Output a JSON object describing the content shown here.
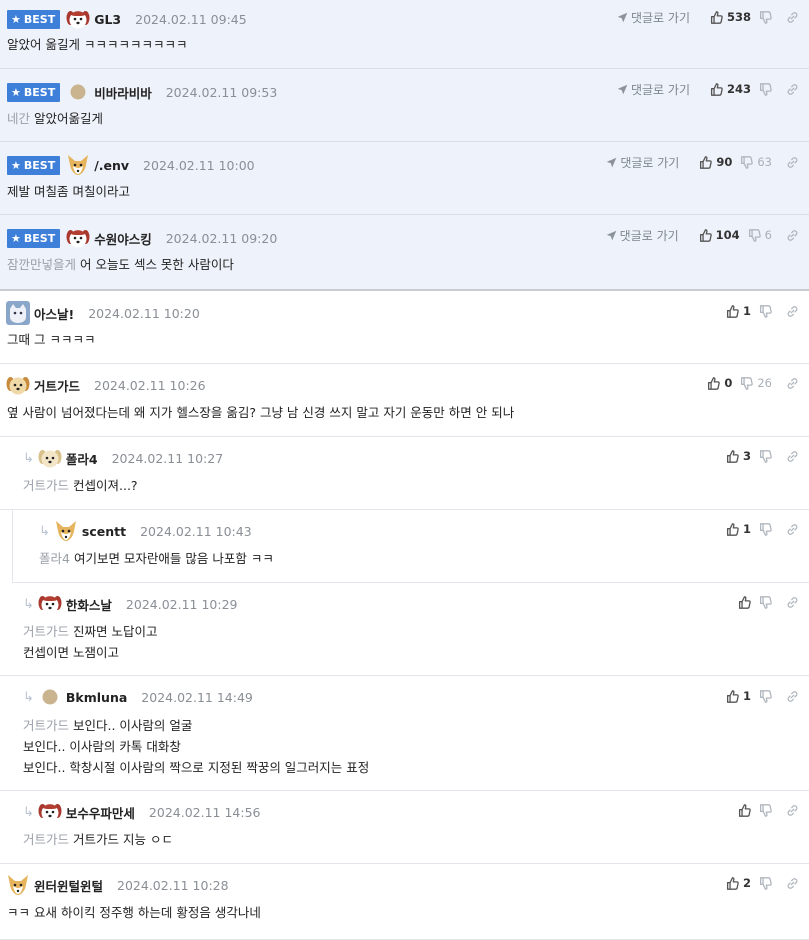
{
  "labels": {
    "best": "BEST",
    "goto_comment": "댓글로 가기"
  },
  "comments": [
    {
      "id": "c1",
      "best": true,
      "avatar": "dog-red",
      "nick": "GL3",
      "date": "2024.02.11 09:45",
      "goto": true,
      "likes": "538",
      "dislikes": "",
      "mention": "",
      "lines": [
        "알았어 옮길게 ㅋㅋㅋㅋㅋㅋㅋㅋㅋ"
      ]
    },
    {
      "id": "c2",
      "best": true,
      "avatar": "dot-tan",
      "nick": "비바라비바",
      "date": "2024.02.11 09:53",
      "goto": true,
      "likes": "243",
      "dislikes": "",
      "mention": "네간",
      "lines": [
        "알았어옮길게"
      ]
    },
    {
      "id": "c3",
      "best": true,
      "avatar": "fox",
      "nick": "/.env",
      "date": "2024.02.11 10:00",
      "goto": true,
      "likes": "90",
      "dislikes": "63",
      "mention": "",
      "lines": [
        "제발 며칠좀 며칠이라고"
      ]
    },
    {
      "id": "c4",
      "best": true,
      "avatar": "dog-red",
      "nick": "수원야스킹",
      "date": "2024.02.11 09:20",
      "goto": true,
      "likes": "104",
      "dislikes": "6",
      "mention": "잠깐만넣을게",
      "lines": [
        "어 오늘도 섹스 못한 사람이다"
      ]
    },
    {
      "id": "c5",
      "best": false,
      "avatar": "cat-blue",
      "nick": "아스날!",
      "date": "2024.02.11 10:20",
      "goto": false,
      "likes": "1",
      "dislikes": "",
      "mention": "",
      "lines": [
        "그때 그 ㅋㅋㅋㅋ"
      ]
    },
    {
      "id": "c6",
      "best": false,
      "avatar": "dog-tan",
      "nick": "거트가드",
      "date": "2024.02.11 10:26",
      "goto": false,
      "likes": "0",
      "dislikes": "26",
      "mention": "",
      "lines": [
        "옆 사람이 넘어졌다는데 왜 지가 헬스장을 옮김? 그냥 남 신경 쓰지 말고 자기 운동만 하면 안 되나"
      ]
    },
    {
      "id": "c7",
      "best": false,
      "reply": 1,
      "avatar": "dog-cream",
      "nick": "폴라4",
      "date": "2024.02.11 10:27",
      "goto": false,
      "likes": "3",
      "dislikes": "",
      "mention": "거트가드",
      "lines": [
        "컨셉이져...?"
      ]
    },
    {
      "id": "c8",
      "best": false,
      "reply": 2,
      "avatar": "fox",
      "nick": "scentt",
      "date": "2024.02.11 10:43",
      "goto": false,
      "likes": "1",
      "dislikes": "",
      "mention": "폴라4",
      "lines": [
        "여기보면 모자란애들 많음 나포함 ㅋㅋ"
      ]
    },
    {
      "id": "c9",
      "best": false,
      "reply": 1,
      "avatar": "dog-red",
      "nick": "한화스날",
      "date": "2024.02.11 10:29",
      "goto": false,
      "likes": "",
      "dislikes": "",
      "mention": "거트가드",
      "lines": [
        "진짜면 노답이고",
        "컨셉이면 노잼이고"
      ]
    },
    {
      "id": "c10",
      "best": false,
      "reply": 1,
      "avatar": "dot-tan",
      "nick": "Bkmluna",
      "date": "2024.02.11 14:49",
      "goto": false,
      "likes": "1",
      "dislikes": "",
      "mention": "거트가드",
      "lines": [
        "보인다.. 이사람의 얼굴",
        "보인다.. 이사람의 카톡 대화창",
        "보인다.. 학창시절 이사람의 짝으로 지정된 짝꿍의 일그러지는 표정"
      ]
    },
    {
      "id": "c11",
      "best": false,
      "reply": 1,
      "avatar": "dog-red",
      "nick": "보수우파만세",
      "date": "2024.02.11 14:56",
      "goto": false,
      "likes": "",
      "dislikes": "",
      "mention": "거트가드",
      "lines": [
        "거트가드 지능 ㅇㄷ"
      ]
    },
    {
      "id": "c12",
      "best": false,
      "avatar": "fox",
      "nick": "윈터윈털윈털",
      "date": "2024.02.11 10:28",
      "goto": false,
      "likes": "2",
      "dislikes": "",
      "mention": "",
      "lines": [
        "ㅋㅋ 요새 하이킥 정주행 하는데 황정음 생각나네"
      ]
    }
  ]
}
